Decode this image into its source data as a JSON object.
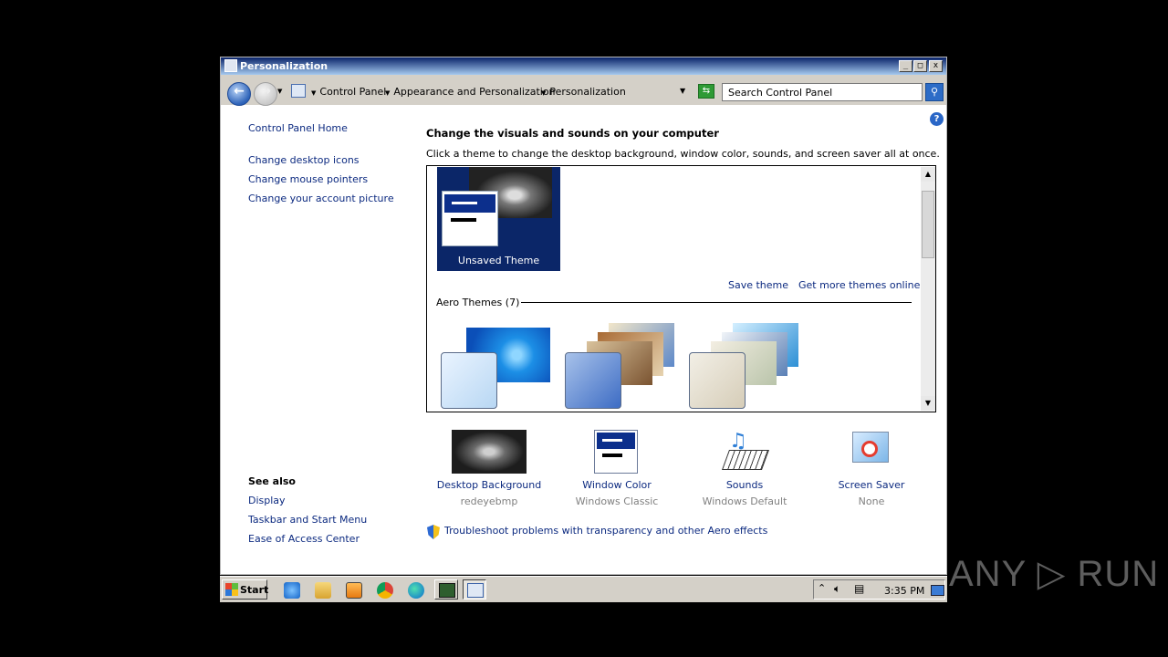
{
  "window": {
    "title": "Personalization"
  },
  "caption_buttons": {
    "minimize": "_",
    "maximize": "□",
    "close": "x"
  },
  "address": {
    "crumbs": [
      "Control Panel",
      "Appearance and Personalization",
      "Personalization"
    ],
    "search_placeholder": "Search Control Panel"
  },
  "left_nav": {
    "home": "Control Panel Home",
    "links": [
      "Change desktop icons",
      "Change mouse pointers",
      "Change your account picture"
    ],
    "see_also_title": "See also",
    "see_also": [
      "Display",
      "Taskbar and Start Menu",
      "Ease of Access Center"
    ]
  },
  "main": {
    "heading": "Change the visuals and sounds on your computer",
    "subheading": "Click a theme to change the desktop background, window color, sounds, and screen saver all at once.",
    "unsaved_theme": "Unsaved Theme",
    "save_theme": "Save theme",
    "get_more_themes": "Get more themes online",
    "aero_label": "Aero Themes (7)",
    "options": [
      {
        "label": "Desktop Background",
        "sub": "redeyebmp",
        "icon": "desktop-background-icon"
      },
      {
        "label": "Window Color",
        "sub": "Windows Classic",
        "icon": "window-color-icon"
      },
      {
        "label": "Sounds",
        "sub": "Windows Default",
        "icon": "sounds-icon"
      },
      {
        "label": "Screen Saver",
        "sub": "None",
        "icon": "screen-saver-icon"
      }
    ],
    "troubleshoot": "Troubleshoot problems with transparency and other Aero effects"
  },
  "taskbar": {
    "start_label": "Start",
    "clock": "3:35 PM"
  },
  "watermark": "ANY ▷ RUN"
}
